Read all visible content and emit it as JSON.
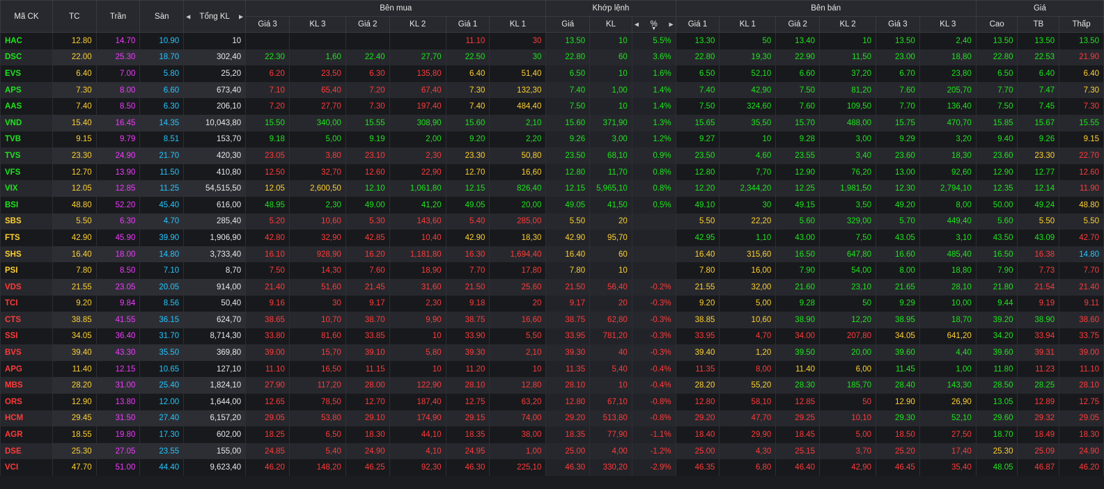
{
  "colors": {
    "up": "#1ee51e",
    "down": "#ff3b3b",
    "ref": "#ffd130",
    "ceil": "#f23aff",
    "floor": "#24c6ff"
  },
  "header": {
    "symbol": "Mã CK",
    "ref": "TC",
    "ceil": "Trần",
    "floor": "Sàn",
    "total_vol": "Tổng KL",
    "buy_group": "Bên mua",
    "match_group": "Khớp lệnh",
    "sell_group": "Bên bán",
    "price_group": "Giá",
    "buy_cols": [
      "Giá 3",
      "KL 3",
      "Giá 2",
      "KL 2",
      "Giá 1",
      "KL 1"
    ],
    "match_cols": [
      "Giá",
      "KL",
      "%"
    ],
    "sell_cols": [
      "Giá 1",
      "KL 1",
      "Giá 2",
      "KL 2",
      "Giá 3",
      "KL 3"
    ],
    "price_cols": [
      "Cao",
      "TB",
      "Thấp"
    ]
  },
  "rows": [
    [
      "HAC",
      "12.80",
      "14.70",
      "10.90",
      "10",
      "",
      "",
      "",
      "",
      "11.10",
      "30",
      "13.50",
      "10",
      "5.5%",
      "13.30",
      "50",
      "13.40",
      "10",
      "13.50",
      "2,40",
      "13.50",
      "13.50",
      "13.50"
    ],
    [
      "DSC",
      "22.00",
      "25.30",
      "18.70",
      "302,40",
      "22.30",
      "1,60",
      "22.40",
      "27,70",
      "22.50",
      "30",
      "22.80",
      "60",
      "3.6%",
      "22.80",
      "19,30",
      "22.90",
      "11,50",
      "23.00",
      "18,80",
      "22.80",
      "22.53",
      "21.90"
    ],
    [
      "EVS",
      "6.40",
      "7.00",
      "5.80",
      "25,20",
      "6.20",
      "23,50",
      "6.30",
      "135,80",
      "6.40",
      "51,40",
      "6.50",
      "10",
      "1.6%",
      "6.50",
      "52,10",
      "6.60",
      "37,20",
      "6.70",
      "23,80",
      "6.50",
      "6.40",
      "6.40"
    ],
    [
      "APS",
      "7.30",
      "8.00",
      "6.60",
      "673,40",
      "7.10",
      "65,40",
      "7.20",
      "67,40",
      "7.30",
      "132,30",
      "7.40",
      "1,00",
      "1.4%",
      "7.40",
      "42,90",
      "7.50",
      "81,20",
      "7.60",
      "205,70",
      "7.70",
      "7.47",
      "7.30"
    ],
    [
      "AAS",
      "7.40",
      "8.50",
      "6.30",
      "206,10",
      "7.20",
      "27,70",
      "7.30",
      "197,40",
      "7.40",
      "484,40",
      "7.50",
      "10",
      "1.4%",
      "7.50",
      "324,60",
      "7.60",
      "109,50",
      "7.70",
      "136,40",
      "7.50",
      "7.45",
      "7.30"
    ],
    [
      "VND",
      "15.40",
      "16.45",
      "14.35",
      "10,043,80",
      "15.50",
      "340,00",
      "15.55",
      "308,90",
      "15.60",
      "2,10",
      "15.60",
      "371,90",
      "1.3%",
      "15.65",
      "35,50",
      "15.70",
      "488,00",
      "15.75",
      "470,70",
      "15.85",
      "15.67",
      "15.55"
    ],
    [
      "TVB",
      "9.15",
      "9.79",
      "8.51",
      "153,70",
      "9.18",
      "5,00",
      "9.19",
      "2,00",
      "9.20",
      "2,20",
      "9.26",
      "3,00",
      "1.2%",
      "9.27",
      "10",
      "9.28",
      "3,00",
      "9.29",
      "3,20",
      "9.40",
      "9.26",
      "9.15"
    ],
    [
      "TVS",
      "23.30",
      "24.90",
      "21.70",
      "420,30",
      "23.05",
      "3,80",
      "23.10",
      "2,30",
      "23.30",
      "50,80",
      "23.50",
      "68,10",
      "0.9%",
      "23.50",
      "4,60",
      "23.55",
      "3,40",
      "23.60",
      "18,30",
      "23.60",
      "23.30",
      "22.70"
    ],
    [
      "VFS",
      "12.70",
      "13.90",
      "11.50",
      "410,80",
      "12.50",
      "32,70",
      "12.60",
      "22,90",
      "12.70",
      "16,60",
      "12.80",
      "11,70",
      "0.8%",
      "12.80",
      "7,70",
      "12.90",
      "76,20",
      "13.00",
      "92,60",
      "12.90",
      "12.77",
      "12.60"
    ],
    [
      "VIX",
      "12.05",
      "12.85",
      "11.25",
      "54,515,50",
      "12.05",
      "2,600,50",
      "12.10",
      "1,061,80",
      "12.15",
      "826,40",
      "12.15",
      "5,965,10",
      "0.8%",
      "12.20",
      "2,344,20",
      "12.25",
      "1,981,50",
      "12.30",
      "2,794,10",
      "12.35",
      "12.14",
      "11.90"
    ],
    [
      "BSI",
      "48.80",
      "52.20",
      "45.40",
      "616,00",
      "48.95",
      "2,30",
      "49.00",
      "41,20",
      "49.05",
      "20,00",
      "49.05",
      "41,50",
      "0.5%",
      "49.10",
      "30",
      "49.15",
      "3,50",
      "49.20",
      "8,00",
      "50.00",
      "49.24",
      "48.80"
    ],
    [
      "SBS",
      "5.50",
      "6.30",
      "4.70",
      "285,40",
      "5.20",
      "10,60",
      "5.30",
      "143,60",
      "5.40",
      "285,00",
      "5.50",
      "20",
      "",
      "5.50",
      "22,20",
      "5.60",
      "329,00",
      "5.70",
      "449,40",
      "5.60",
      "5.50",
      "5.50"
    ],
    [
      "FTS",
      "42.90",
      "45.90",
      "39.90",
      "1,906,90",
      "42.80",
      "32,90",
      "42.85",
      "10,40",
      "42.90",
      "18,30",
      "42.90",
      "95,70",
      "",
      "42.95",
      "1,10",
      "43.00",
      "7,50",
      "43.05",
      "3,10",
      "43.50",
      "43.09",
      "42.70"
    ],
    [
      "SHS",
      "16.40",
      "18.00",
      "14.80",
      "3,733,40",
      "16.10",
      "928,90",
      "16.20",
      "1,181,80",
      "16.30",
      "1,694,40",
      "16.40",
      "60",
      "",
      "16.40",
      "315,60",
      "16.50",
      "647,80",
      "16.60",
      "485,40",
      "16.50",
      "16.38",
      "14.80"
    ],
    [
      "PSI",
      "7.80",
      "8.50",
      "7.10",
      "8,70",
      "7.50",
      "14,30",
      "7.60",
      "18,90",
      "7.70",
      "17,80",
      "7.80",
      "10",
      "",
      "7.80",
      "16,00",
      "7.90",
      "54,00",
      "8.00",
      "18,80",
      "7.90",
      "7.73",
      "7.70"
    ],
    [
      "VDS",
      "21.55",
      "23.05",
      "20.05",
      "914,00",
      "21.40",
      "51,60",
      "21.45",
      "31,60",
      "21.50",
      "25,60",
      "21.50",
      "56,40",
      "-0.2%",
      "21.55",
      "32,00",
      "21.60",
      "23,10",
      "21.65",
      "28,10",
      "21.80",
      "21.54",
      "21.40"
    ],
    [
      "TCI",
      "9.20",
      "9.84",
      "8.56",
      "50,40",
      "9.16",
      "30",
      "9.17",
      "2,30",
      "9.18",
      "20",
      "9.17",
      "20",
      "-0.3%",
      "9.20",
      "5,00",
      "9.28",
      "50",
      "9.29",
      "10,00",
      "9.44",
      "9.19",
      "9.11"
    ],
    [
      "CTS",
      "38.85",
      "41.55",
      "36.15",
      "624,70",
      "38.65",
      "10,70",
      "38.70",
      "9,90",
      "38.75",
      "16,60",
      "38.75",
      "62,80",
      "-0.3%",
      "38.85",
      "10,60",
      "38.90",
      "12,20",
      "38.95",
      "18,70",
      "39.20",
      "38.90",
      "38.60"
    ],
    [
      "SSI",
      "34.05",
      "36.40",
      "31.70",
      "8,714,30",
      "33.80",
      "81,60",
      "33.85",
      "10",
      "33.90",
      "5,50",
      "33.95",
      "781,20",
      "-0.3%",
      "33.95",
      "4,70",
      "34.00",
      "207,80",
      "34.05",
      "641,20",
      "34.20",
      "33.94",
      "33.75"
    ],
    [
      "BVS",
      "39.40",
      "43.30",
      "35.50",
      "369,80",
      "39.00",
      "15,70",
      "39.10",
      "5,80",
      "39.30",
      "2,10",
      "39.30",
      "40",
      "-0.3%",
      "39.40",
      "1,20",
      "39.50",
      "20,00",
      "39.60",
      "4,40",
      "39.60",
      "39.31",
      "39.00"
    ],
    [
      "APG",
      "11.40",
      "12.15",
      "10.65",
      "127,10",
      "11.10",
      "16,50",
      "11.15",
      "10",
      "11.20",
      "10",
      "11.35",
      "5,40",
      "-0.4%",
      "11.35",
      "8,00",
      "11.40",
      "6,00",
      "11.45",
      "1,00",
      "11.80",
      "11.23",
      "11.10"
    ],
    [
      "MBS",
      "28.20",
      "31.00",
      "25.40",
      "1,824,10",
      "27.90",
      "117,20",
      "28.00",
      "122,90",
      "28.10",
      "12,80",
      "28.10",
      "10",
      "-0.4%",
      "28.20",
      "55,20",
      "28.30",
      "185,70",
      "28.40",
      "143,30",
      "28.50",
      "28.25",
      "28.10"
    ],
    [
      "ORS",
      "12.90",
      "13.80",
      "12.00",
      "1,644,00",
      "12.65",
      "78,50",
      "12.70",
      "187,40",
      "12.75",
      "63,20",
      "12.80",
      "67,10",
      "-0.8%",
      "12.80",
      "58,10",
      "12.85",
      "50",
      "12.90",
      "26,90",
      "13.05",
      "12.89",
      "12.75"
    ],
    [
      "HCM",
      "29.45",
      "31.50",
      "27.40",
      "6,157,20",
      "29.05",
      "53,80",
      "29.10",
      "174,90",
      "29.15",
      "74,00",
      "29.20",
      "513,80",
      "-0.8%",
      "29.20",
      "47,70",
      "29.25",
      "10,10",
      "29.30",
      "52,10",
      "29.60",
      "29.32",
      "29.05"
    ],
    [
      "AGR",
      "18.55",
      "19.80",
      "17.30",
      "602,00",
      "18.25",
      "6,50",
      "18.30",
      "44,10",
      "18.35",
      "38,00",
      "18.35",
      "77,90",
      "-1.1%",
      "18.40",
      "29,90",
      "18.45",
      "5,00",
      "18.50",
      "27,50",
      "18.70",
      "18.49",
      "18.30"
    ],
    [
      "DSE",
      "25.30",
      "27.05",
      "23.55",
      "155,00",
      "24.85",
      "5,40",
      "24.90",
      "4,10",
      "24.95",
      "1,00",
      "25.00",
      "4,00",
      "-1.2%",
      "25.00",
      "4,30",
      "25.15",
      "3,70",
      "25.20",
      "17,40",
      "25.30",
      "25.09",
      "24.90"
    ],
    [
      "VCI",
      "47.70",
      "51.00",
      "44.40",
      "9,623,40",
      "46.20",
      "148,20",
      "46.25",
      "92,30",
      "46.30",
      "225,10",
      "46.30",
      "330,20",
      "-2.9%",
      "46.35",
      "6,80",
      "46.40",
      "42,90",
      "46.45",
      "35,40",
      "48.05",
      "46.87",
      "46.20"
    ]
  ],
  "row_colors": [
    [
      "up",
      "ref",
      "ceil",
      "floor",
      "white",
      "",
      "",
      "",
      "",
      "down",
      "down",
      "up",
      "up",
      "up",
      "up",
      "up",
      "up",
      "up",
      "up",
      "up",
      "up",
      "up",
      "up"
    ],
    [
      "up",
      "ref",
      "ceil",
      "floor",
      "white",
      "up",
      "up",
      "up",
      "up",
      "up",
      "up",
      "up",
      "up",
      "up",
      "up",
      "up",
      "up",
      "up",
      "up",
      "up",
      "up",
      "up",
      "down"
    ],
    [
      "up",
      "ref",
      "ceil",
      "floor",
      "white",
      "down",
      "down",
      "down",
      "down",
      "ref",
      "ref",
      "up",
      "up",
      "up",
      "up",
      "up",
      "up",
      "up",
      "up",
      "up",
      "up",
      "up",
      "ref"
    ],
    [
      "up",
      "ref",
      "ceil",
      "floor",
      "white",
      "down",
      "down",
      "down",
      "down",
      "ref",
      "ref",
      "up",
      "up",
      "up",
      "up",
      "up",
      "up",
      "up",
      "up",
      "up",
      "up",
      "up",
      "ref"
    ],
    [
      "up",
      "ref",
      "ceil",
      "floor",
      "white",
      "down",
      "down",
      "down",
      "down",
      "ref",
      "ref",
      "up",
      "up",
      "up",
      "up",
      "up",
      "up",
      "up",
      "up",
      "up",
      "up",
      "up",
      "down"
    ],
    [
      "up",
      "ref",
      "ceil",
      "floor",
      "white",
      "up",
      "up",
      "up",
      "up",
      "up",
      "up",
      "up",
      "up",
      "up",
      "up",
      "up",
      "up",
      "up",
      "up",
      "up",
      "up",
      "up",
      "up"
    ],
    [
      "up",
      "ref",
      "ceil",
      "floor",
      "white",
      "up",
      "up",
      "up",
      "up",
      "up",
      "up",
      "up",
      "up",
      "up",
      "up",
      "up",
      "up",
      "up",
      "up",
      "up",
      "up",
      "up",
      "ref"
    ],
    [
      "up",
      "ref",
      "ceil",
      "floor",
      "white",
      "down",
      "down",
      "down",
      "down",
      "ref",
      "ref",
      "up",
      "up",
      "up",
      "up",
      "up",
      "up",
      "up",
      "up",
      "up",
      "up",
      "ref",
      "down"
    ],
    [
      "up",
      "ref",
      "ceil",
      "floor",
      "white",
      "down",
      "down",
      "down",
      "down",
      "ref",
      "ref",
      "up",
      "up",
      "up",
      "up",
      "up",
      "up",
      "up",
      "up",
      "up",
      "up",
      "up",
      "down"
    ],
    [
      "up",
      "ref",
      "ceil",
      "floor",
      "white",
      "ref",
      "ref",
      "up",
      "up",
      "up",
      "up",
      "up",
      "up",
      "up",
      "up",
      "up",
      "up",
      "up",
      "up",
      "up",
      "up",
      "up",
      "down"
    ],
    [
      "up",
      "ref",
      "ceil",
      "floor",
      "white",
      "up",
      "up",
      "up",
      "up",
      "up",
      "up",
      "up",
      "up",
      "up",
      "up",
      "up",
      "up",
      "up",
      "up",
      "up",
      "up",
      "up",
      "ref"
    ],
    [
      "ref",
      "ref",
      "ceil",
      "floor",
      "white",
      "down",
      "down",
      "down",
      "down",
      "down",
      "down",
      "ref",
      "ref",
      "ref",
      "ref",
      "ref",
      "up",
      "up",
      "up",
      "up",
      "up",
      "ref",
      "ref"
    ],
    [
      "ref",
      "ref",
      "ceil",
      "floor",
      "white",
      "down",
      "down",
      "down",
      "down",
      "ref",
      "ref",
      "ref",
      "ref",
      "ref",
      "up",
      "up",
      "up",
      "up",
      "up",
      "up",
      "up",
      "up",
      "down"
    ],
    [
      "ref",
      "ref",
      "ceil",
      "floor",
      "white",
      "down",
      "down",
      "down",
      "down",
      "down",
      "down",
      "ref",
      "ref",
      "ref",
      "ref",
      "ref",
      "up",
      "up",
      "up",
      "up",
      "up",
      "down",
      "floor"
    ],
    [
      "ref",
      "ref",
      "ceil",
      "floor",
      "white",
      "down",
      "down",
      "down",
      "down",
      "down",
      "down",
      "ref",
      "ref",
      "ref",
      "ref",
      "ref",
      "up",
      "up",
      "up",
      "up",
      "up",
      "down",
      "down"
    ],
    [
      "down",
      "ref",
      "ceil",
      "floor",
      "white",
      "down",
      "down",
      "down",
      "down",
      "down",
      "down",
      "down",
      "down",
      "down",
      "ref",
      "ref",
      "up",
      "up",
      "up",
      "up",
      "up",
      "down",
      "down"
    ],
    [
      "down",
      "ref",
      "ceil",
      "floor",
      "white",
      "down",
      "down",
      "down",
      "down",
      "down",
      "down",
      "down",
      "down",
      "down",
      "ref",
      "ref",
      "up",
      "up",
      "up",
      "up",
      "up",
      "down",
      "down"
    ],
    [
      "down",
      "ref",
      "ceil",
      "floor",
      "white",
      "down",
      "down",
      "down",
      "down",
      "down",
      "down",
      "down",
      "down",
      "down",
      "ref",
      "ref",
      "up",
      "up",
      "up",
      "up",
      "up",
      "up",
      "down"
    ],
    [
      "down",
      "ref",
      "ceil",
      "floor",
      "white",
      "down",
      "down",
      "down",
      "down",
      "down",
      "down",
      "down",
      "down",
      "down",
      "down",
      "down",
      "down",
      "down",
      "ref",
      "ref",
      "up",
      "down",
      "down"
    ],
    [
      "down",
      "ref",
      "ceil",
      "floor",
      "white",
      "down",
      "down",
      "down",
      "down",
      "down",
      "down",
      "down",
      "down",
      "down",
      "ref",
      "ref",
      "up",
      "up",
      "up",
      "up",
      "up",
      "down",
      "down"
    ],
    [
      "down",
      "ref",
      "ceil",
      "floor",
      "white",
      "down",
      "down",
      "down",
      "down",
      "down",
      "down",
      "down",
      "down",
      "down",
      "down",
      "down",
      "ref",
      "ref",
      "up",
      "up",
      "up",
      "down",
      "down"
    ],
    [
      "down",
      "ref",
      "ceil",
      "floor",
      "white",
      "down",
      "down",
      "down",
      "down",
      "down",
      "down",
      "down",
      "down",
      "down",
      "ref",
      "ref",
      "up",
      "up",
      "up",
      "up",
      "up",
      "up",
      "down"
    ],
    [
      "down",
      "ref",
      "ceil",
      "floor",
      "white",
      "down",
      "down",
      "down",
      "down",
      "down",
      "down",
      "down",
      "down",
      "down",
      "down",
      "down",
      "down",
      "down",
      "ref",
      "ref",
      "up",
      "down",
      "down"
    ],
    [
      "down",
      "ref",
      "ceil",
      "floor",
      "white",
      "down",
      "down",
      "down",
      "down",
      "down",
      "down",
      "down",
      "down",
      "down",
      "down",
      "down",
      "down",
      "down",
      "up",
      "up",
      "up",
      "down",
      "down"
    ],
    [
      "down",
      "ref",
      "ceil",
      "floor",
      "white",
      "down",
      "down",
      "down",
      "down",
      "down",
      "down",
      "down",
      "down",
      "down",
      "down",
      "down",
      "down",
      "down",
      "down",
      "down",
      "up",
      "down",
      "down"
    ],
    [
      "down",
      "ref",
      "ceil",
      "floor",
      "white",
      "down",
      "down",
      "down",
      "down",
      "down",
      "down",
      "down",
      "down",
      "down",
      "down",
      "down",
      "down",
      "down",
      "down",
      "down",
      "ref",
      "down",
      "down"
    ],
    [
      "down",
      "ref",
      "ceil",
      "floor",
      "white",
      "down",
      "down",
      "down",
      "down",
      "down",
      "down",
      "down",
      "down",
      "down",
      "down",
      "down",
      "down",
      "down",
      "down",
      "down",
      "up",
      "down",
      "down"
    ]
  ],
  "icons": {
    "prev": "caret-left-icon",
    "next": "caret-right-icon",
    "sort": "sort-down-icon"
  }
}
